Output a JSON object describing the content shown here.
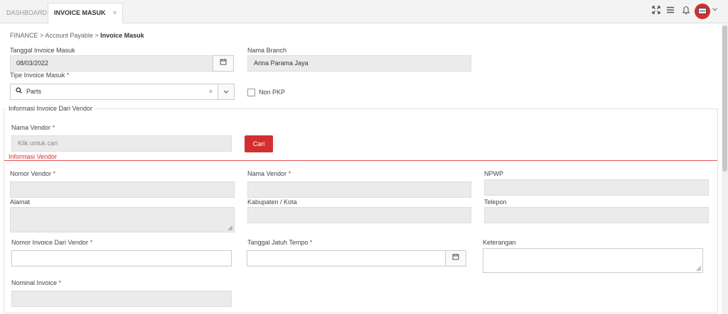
{
  "tabs": [
    {
      "label": "DASHBOARD"
    },
    {
      "label": "INVOICE MASUK",
      "close": "×"
    }
  ],
  "topbar": {
    "icons": [
      "expand-icon",
      "menu-icon",
      "bell-icon",
      "avatar",
      "chevron-down-icon"
    ]
  },
  "breadcrumb": {
    "level1": "FINANCE",
    "sep": ">",
    "level2": "Account Payable",
    "level3": "Invoice Masuk"
  },
  "form": {
    "tanggal_label": "Tanggal Invoice Masuk",
    "tanggal_value": "08/03/2022",
    "branch_label": "Nama Branch",
    "branch_value": "Arina Parama Jaya",
    "tipe_label": "Tipe Invoice Masuk",
    "required_mark": "*",
    "tipe_value": "Parts",
    "tipe_clear": "×",
    "nonpkp_label": "Non PKP"
  },
  "vendor_section": {
    "legend": "Informasi Invoice Dari Vendor",
    "nama_vendor_label": "Nama Vendor",
    "nama_vendor_placeholder": "Klik untuk cari",
    "cari_button": "Cari",
    "info_vendor_title": "Informasi Vendor",
    "nomor_vendor_label": "Nomor Vendor",
    "nama_vendor2_label": "Nama Vendor",
    "npwp_label": "NPWP",
    "alamat_label": "Alamat",
    "kabupaten_label": "Kabupaten / Kota",
    "telepon_label": "Telepon",
    "nomor_invoice_label": "Nomor Invoice Dari Vendor",
    "jatuh_tempo_label": "Tanggal Jatuh Tempo",
    "keterangan_label": "Keterangan",
    "nominal_label": "Nominal Invoice"
  },
  "colors": {
    "accent": "#d32f2f",
    "readonly_bg": "#ebebeb"
  }
}
